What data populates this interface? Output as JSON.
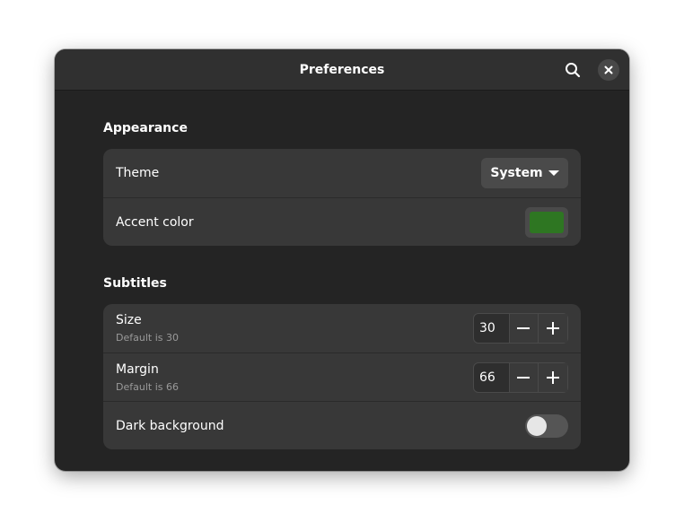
{
  "window": {
    "title": "Preferences"
  },
  "icons": {
    "search": "search-icon",
    "close": "close-icon",
    "caret": "pan-down-icon",
    "minus": "minus-icon",
    "plus": "plus-icon"
  },
  "appearance": {
    "heading": "Appearance",
    "theme": {
      "label": "Theme",
      "value": "System"
    },
    "accent": {
      "label": "Accent color",
      "color": "#2e7622"
    }
  },
  "subtitles": {
    "heading": "Subtitles",
    "size": {
      "label": "Size",
      "hint": "Default is 30",
      "value": "30"
    },
    "margin": {
      "label": "Margin",
      "hint": "Default is 66",
      "value": "66"
    },
    "dark_background": {
      "label": "Dark background",
      "enabled": false
    }
  }
}
